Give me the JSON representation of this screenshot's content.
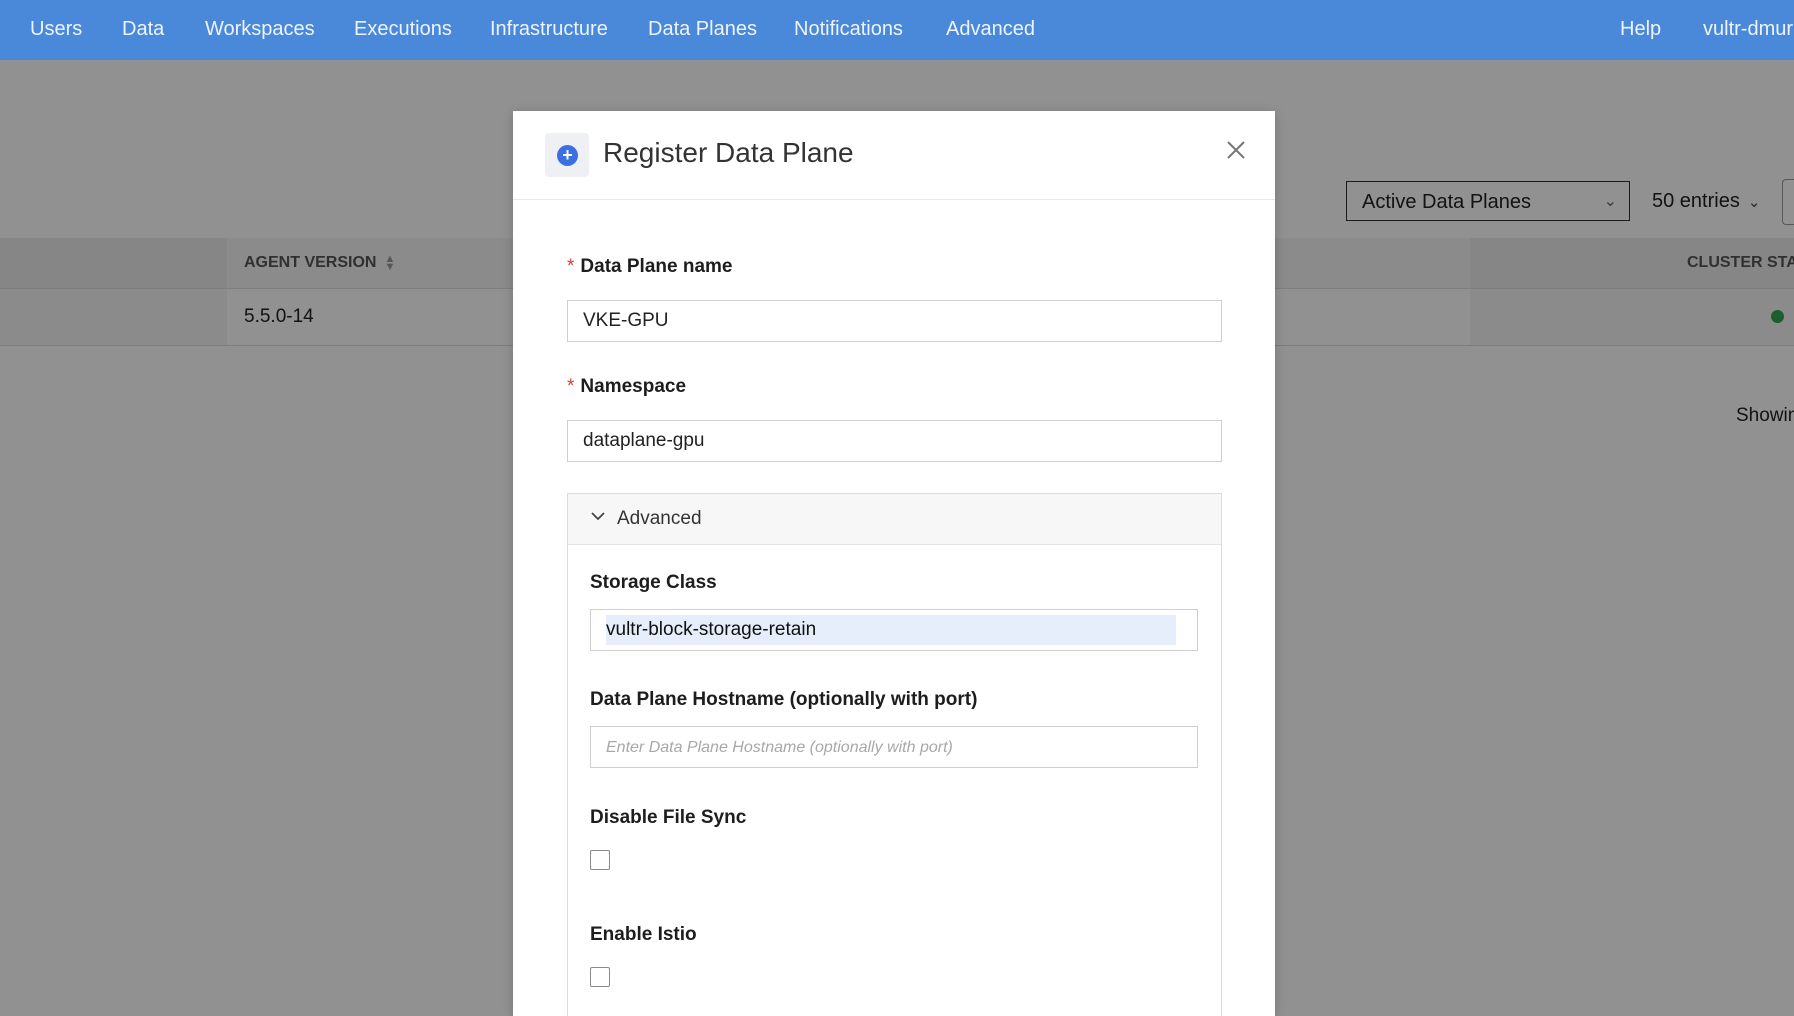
{
  "nav": {
    "items": [
      {
        "label": "Users"
      },
      {
        "label": "Data"
      },
      {
        "label": "Workspaces"
      },
      {
        "label": "Executions"
      },
      {
        "label": "Infrastructure"
      },
      {
        "label": "Data Planes"
      },
      {
        "label": "Notifications"
      },
      {
        "label": "Advanced"
      }
    ],
    "help": "Help",
    "user": "vultr-dmurr"
  },
  "background": {
    "filter_select": "Active Data Planes",
    "entries_select": "50 entries",
    "columns": {
      "agent_version": "AGENT VERSION",
      "cluster_status": "CLUSTER STAT"
    },
    "row": {
      "agent_version": "5.5.0-14",
      "status_color": "#2fa84f"
    },
    "showing": "Showin"
  },
  "modal": {
    "title": "Register Data Plane",
    "name_field": {
      "label": "Data Plane name",
      "value": "VKE-GPU"
    },
    "namespace_field": {
      "label": "Namespace",
      "value": "dataplane-gpu"
    },
    "advanced": {
      "label": "Advanced",
      "storage_class": {
        "label": "Storage Class",
        "value": "vultr-block-storage-retain"
      },
      "hostname": {
        "label": "Data Plane Hostname (optionally with port)",
        "placeholder": "Enter Data Plane Hostname (optionally with port)"
      },
      "disable_file_sync": {
        "label": "Disable File Sync",
        "checked": false
      },
      "enable_istio": {
        "label": "Enable Istio",
        "checked": false
      }
    }
  },
  "colors": {
    "nav_bg": "#4a88da",
    "required_asterisk": "#e0393e",
    "accent": "#3d6fe0"
  }
}
